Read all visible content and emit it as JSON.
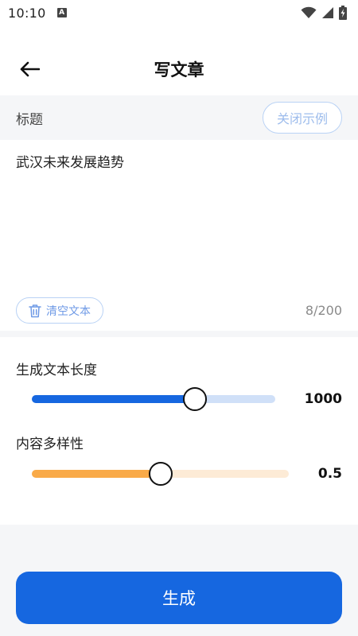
{
  "status_bar": {
    "time": "10:10",
    "notification_icon": "a-letter-icon"
  },
  "header": {
    "title": "写文章",
    "back_icon": "arrow-left-icon"
  },
  "title_row": {
    "label": "标题",
    "close_example_label": "关闭示例"
  },
  "editor": {
    "text": "武汉未来发展趋势",
    "clear_label": "清空文本",
    "clear_icon": "trash-icon",
    "char_count": "8/200"
  },
  "sliders": {
    "length": {
      "label": "生成文本长度",
      "value_text": "1000",
      "fraction": 0.67,
      "fill_color": "#1667e0",
      "track_color": "#d0e0f8"
    },
    "diversity": {
      "label": "内容多样性",
      "value_text": "0.5",
      "fraction": 0.5,
      "fill_color": "#f9aa48",
      "track_color": "#fdebd6"
    }
  },
  "footer": {
    "generate_label": "生成",
    "generate_color": "#1667e0"
  }
}
